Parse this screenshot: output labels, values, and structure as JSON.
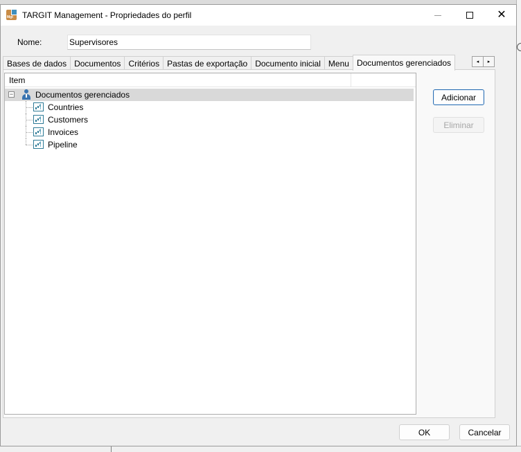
{
  "window": {
    "title": "TARGIT Management - Propriedades do perfil",
    "app_icon_text": "Mgt"
  },
  "name_field": {
    "label": "Nome:",
    "value": "Supervisores"
  },
  "tabs": [
    {
      "label": "Bases de dados",
      "active": false
    },
    {
      "label": "Documentos",
      "active": false
    },
    {
      "label": "Critérios",
      "active": false
    },
    {
      "label": "Pastas de exportação",
      "active": false
    },
    {
      "label": "Documento inicial",
      "active": false
    },
    {
      "label": "Menu",
      "active": false
    },
    {
      "label": "Documentos gerenciados",
      "active": true
    }
  ],
  "tab_scroll": {
    "left": "◂",
    "right": "▸"
  },
  "tree": {
    "column_header": "Item",
    "root": {
      "label": "Documentos gerenciados",
      "expanded_symbol": "−",
      "icon": "user-icon",
      "children": [
        {
          "label": "Countries",
          "icon": "document-icon"
        },
        {
          "label": "Customers",
          "icon": "document-icon"
        },
        {
          "label": "Invoices",
          "icon": "document-icon"
        },
        {
          "label": "Pipeline",
          "icon": "document-icon"
        }
      ]
    }
  },
  "buttons": {
    "add": "Adicionar",
    "remove": "Eliminar",
    "ok": "OK",
    "cancel": "Cancelar"
  },
  "colors": {
    "selection": "#d9d9d9",
    "default_button_border": "#2b6fb4",
    "document_icon": "#2d7a96",
    "user_icon": "#3a74b0"
  }
}
